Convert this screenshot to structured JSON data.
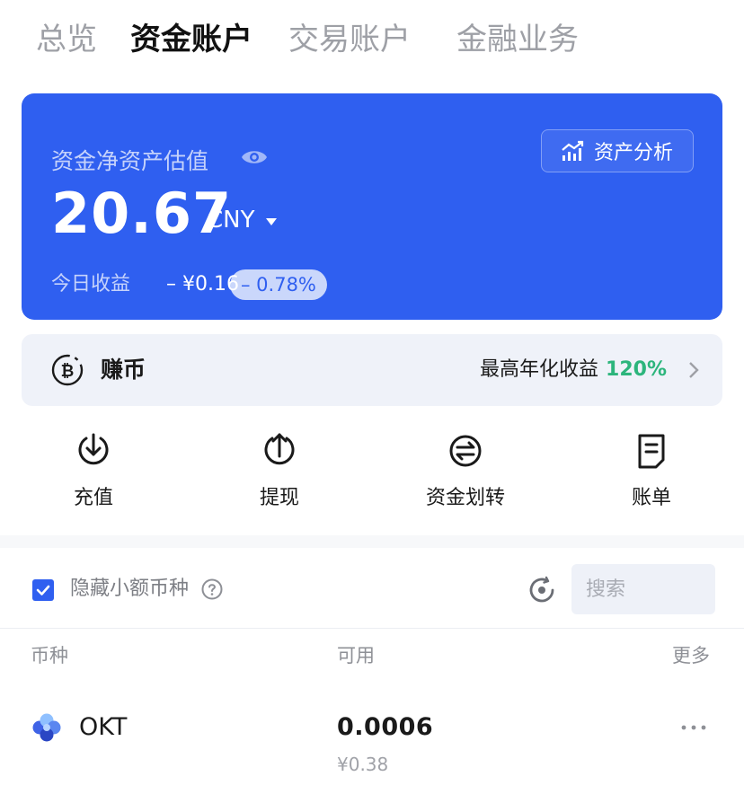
{
  "tabs": [
    {
      "label": "总览",
      "active": false
    },
    {
      "label": "资金账户",
      "active": true
    },
    {
      "label": "交易账户",
      "active": false
    },
    {
      "label": "金融业务",
      "active": false
    }
  ],
  "card": {
    "label": "资金净资产估值",
    "analysis_label": "资产分析",
    "amount": "20.67",
    "currency": "CNY",
    "today_label": "今日收益",
    "today_value": "– ¥0.16",
    "today_pct": "– 0.78%",
    "bg_color": "#2f5ff0"
  },
  "earn": {
    "label": "赚币",
    "yield_label": "最高年化收益",
    "yield_value": "120%",
    "yield_color": "#2cb57c"
  },
  "actions": [
    {
      "label": "充值",
      "icon": "deposit-icon"
    },
    {
      "label": "提现",
      "icon": "withdraw-icon"
    },
    {
      "label": "资金划转",
      "icon": "transfer-icon"
    },
    {
      "label": "账单",
      "icon": "bill-icon"
    }
  ],
  "filter": {
    "hide_small_label": "隐藏小额币种",
    "hide_small_checked": true,
    "search_placeholder": "搜索"
  },
  "table": {
    "headers": {
      "coin": "币种",
      "available": "可用",
      "more": "更多"
    },
    "rows": [
      {
        "coin": "OKT",
        "available": "0.0006",
        "available_cny": "¥0.38"
      }
    ]
  }
}
